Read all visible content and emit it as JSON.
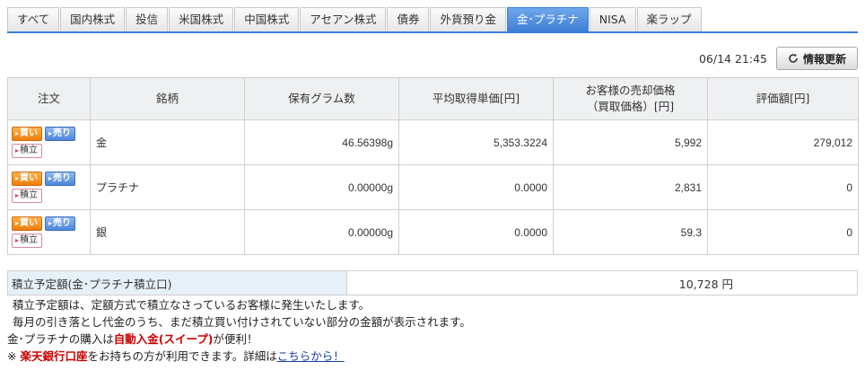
{
  "tabs": [
    {
      "label": "すべて",
      "active": false
    },
    {
      "label": "国内株式",
      "active": false
    },
    {
      "label": "投信",
      "active": false
    },
    {
      "label": "米国株式",
      "active": false
    },
    {
      "label": "中国株式",
      "active": false
    },
    {
      "label": "アセアン株式",
      "active": false
    },
    {
      "label": "債券",
      "active": false
    },
    {
      "label": "外貨預り金",
      "active": false
    },
    {
      "label": "金･プラチナ",
      "active": true
    },
    {
      "label": "NISA",
      "active": false
    },
    {
      "label": "楽ラップ",
      "active": false
    }
  ],
  "update": {
    "timestamp": "06/14 21:45",
    "refresh_label": "情報更新"
  },
  "table": {
    "headers": {
      "order": "注文",
      "name": "銘柄",
      "grams": "保有グラム数",
      "avg_line1": "平均取得単価[円]",
      "sell_line1": "お客様の売却価格",
      "sell_line2": "（買取価格）[円]",
      "value": "評価額[円]"
    },
    "buttons": {
      "buy": "買い",
      "sell": "売り",
      "accumulate": "積立"
    },
    "rows": [
      {
        "name": "金",
        "grams": "46.56398g",
        "avg": "5,353.3224",
        "sell_price": "5,992",
        "value": "279,012"
      },
      {
        "name": "プラチナ",
        "grams": "0.00000g",
        "avg": "0.0000",
        "sell_price": "2,831",
        "value": "0"
      },
      {
        "name": "銀",
        "grams": "0.00000g",
        "avg": "0.0000",
        "sell_price": "59.3",
        "value": "0"
      }
    ]
  },
  "plan": {
    "label": "積立予定額(金･プラチナ積立口)",
    "value": "10,728 円"
  },
  "notes": {
    "line1": "積立予定額は、定額方式で積立なさっているお客様に発生いたします。",
    "line2": "毎月の引き落とし代金のうち、まだ積立買い付けされていない部分の金額が表示されます。",
    "line3_pre": "金･プラチナの購入は",
    "line3_red": "自動入金(スイープ)",
    "line3_post": "が便利！",
    "line4_mark": "※",
    "line4_red": "楽天銀行口座",
    "line4_mid": "をお持ちの方が利用できます。詳細は",
    "line4_link": "こちらから！"
  },
  "colors": {
    "tab_active": "#3d7fd6",
    "buy_button": "#f07d0c",
    "sell_button": "#4d86d9",
    "header_bg": "#eef0f2",
    "plan_label_bg": "#e6f0f8",
    "emphasis_red": "#cc0000",
    "link_blue": "#1a3fa8"
  }
}
